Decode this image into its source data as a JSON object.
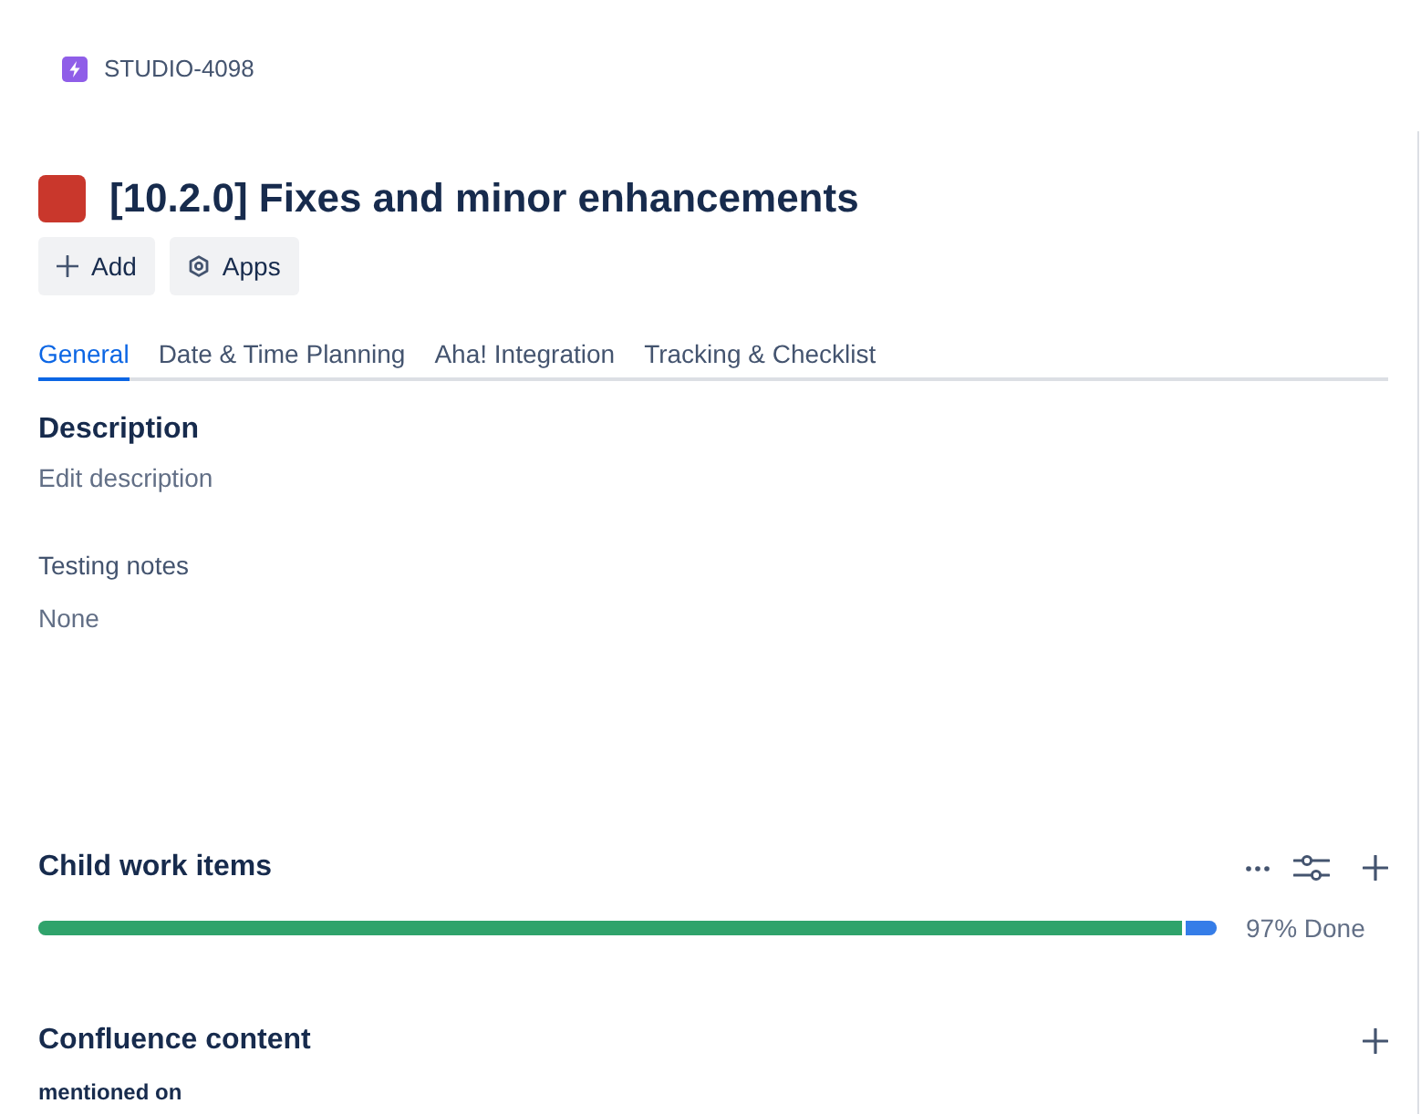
{
  "breadcrumb": {
    "key": "STUDIO-4098"
  },
  "issue": {
    "title": "[10.2.0] Fixes and minor enhancements"
  },
  "actions": [
    {
      "kind": "add",
      "label": "Add"
    },
    {
      "kind": "apps",
      "label": "Apps"
    }
  ],
  "tabs": [
    {
      "label": "General",
      "selected": true
    },
    {
      "label": "Date & Time Planning",
      "selected": false
    },
    {
      "label": "Aha! Integration",
      "selected": false
    },
    {
      "label": "Tracking & Checklist",
      "selected": false
    }
  ],
  "fields": [
    {
      "kind": "heading",
      "label": "Description",
      "value": "Edit description"
    },
    {
      "kind": "plain",
      "label": "Testing notes",
      "value": "None"
    }
  ],
  "child_work_items": {
    "title": "Child work items",
    "progress": [
      {
        "kind": "done",
        "level": 0.97
      },
      {
        "kind": "in_progress",
        "level": 0.03
      }
    ],
    "summary": "97% Done"
  },
  "confluence": {
    "title": "Confluence content",
    "subheading": "mentioned on"
  }
}
